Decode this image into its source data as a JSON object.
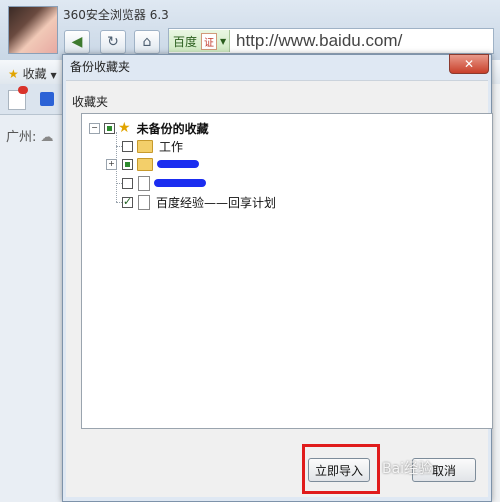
{
  "browser": {
    "title": "360安全浏览器 6.3",
    "address": {
      "cert_label": "百度",
      "cert_badge": "证",
      "url": "http://www.baidu.com/"
    },
    "bookmarks_label": "收藏",
    "city": "广州:"
  },
  "dialog": {
    "title": "备份收藏夹",
    "close_symbol": "✕",
    "section_label": "收藏夹",
    "tree": {
      "root": {
        "label": "未备份的收藏",
        "state": "partial",
        "icon": "star-icon"
      },
      "items": [
        {
          "label": "工作",
          "state": "unchecked",
          "icon": "folder-icon"
        },
        {
          "label": "",
          "state": "partial",
          "icon": "folder-icon",
          "redacted": true
        },
        {
          "label": "",
          "state": "unchecked",
          "icon": "document-icon",
          "redacted": true
        },
        {
          "label": "百度经验——回享计划",
          "state": "checked",
          "icon": "document-icon"
        }
      ]
    },
    "buttons": {
      "import": "立即导入",
      "cancel": "取消"
    }
  },
  "annotations": {
    "highlight_color": "#e01b1b"
  },
  "watermark": "Bai经验"
}
